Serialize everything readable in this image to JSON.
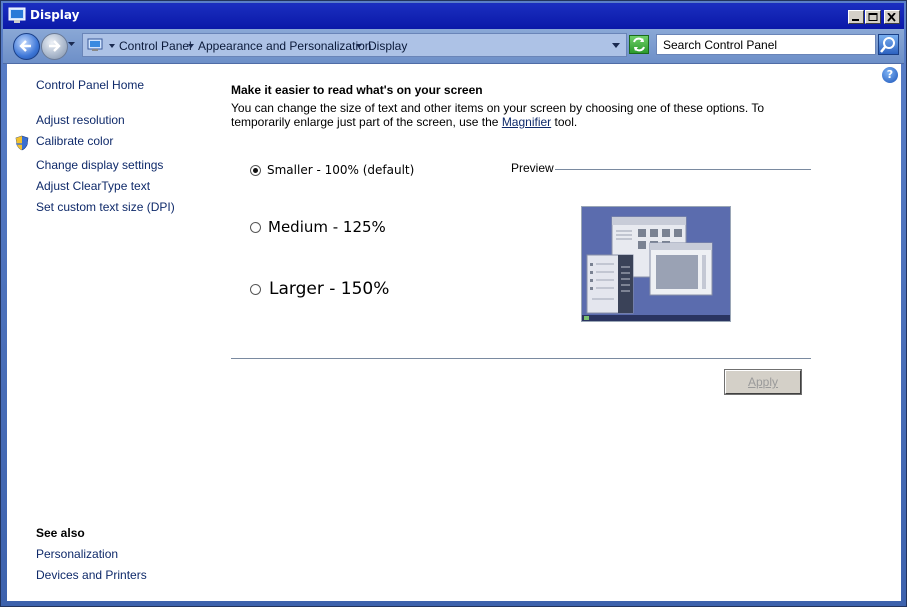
{
  "window": {
    "title": "Display"
  },
  "address": {
    "crumbs": [
      "Control Panel",
      "Appearance and Personalization",
      "Display"
    ]
  },
  "search": {
    "placeholder": "Search Control Panel"
  },
  "sidebar": {
    "home": "Control Panel Home",
    "links": [
      "Adjust resolution",
      "Calibrate color",
      "Change display settings",
      "Adjust ClearType text",
      "Set custom text size (DPI)"
    ],
    "see_also_title": "See also",
    "see_also": [
      "Personalization",
      "Devices and Printers"
    ]
  },
  "main": {
    "heading": "Make it easier to read what's on your screen",
    "desc_before": "You can change the size of text and other items on your screen by choosing one of these options. To temporarily enlarge just part of the screen, use the ",
    "desc_link": "Magnifier",
    "desc_after": " tool.",
    "options": [
      {
        "label": "Smaller - 100% (default)",
        "selected": true
      },
      {
        "label": "Medium - 125%",
        "selected": false
      },
      {
        "label": "Larger - 150%",
        "selected": false
      }
    ],
    "preview_label": "Preview",
    "apply_label": "Apply"
  },
  "icons": {
    "title": "display-icon",
    "back": "back-arrow-icon",
    "forward": "forward-arrow-icon",
    "refresh": "refresh-icon",
    "search": "search-icon",
    "help": "help-icon",
    "shield": "uac-shield-icon"
  },
  "colors": {
    "titlebar": "#0a18a8",
    "link": "#0f2a6a",
    "accent": "#3f78d8"
  }
}
